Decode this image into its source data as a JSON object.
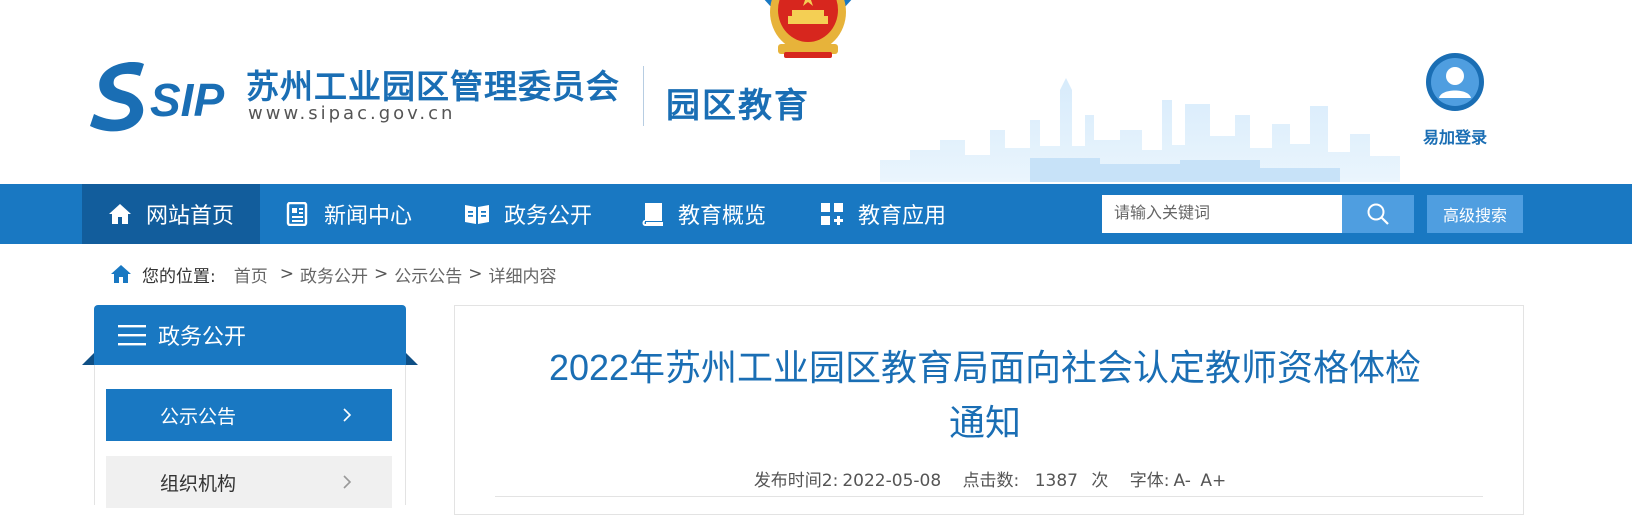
{
  "header": {
    "logo_text": "SIP",
    "org_name": "苏州工业园区管理委员会",
    "org_url": "www.sipac.gov.cn",
    "section_name": "园区教育",
    "login_label": "易加登录"
  },
  "nav": {
    "items": [
      {
        "label": "网站首页",
        "icon": "home-icon",
        "active": true
      },
      {
        "label": "新闻中心",
        "icon": "news-icon",
        "active": false
      },
      {
        "label": "政务公开",
        "icon": "book-icon",
        "active": false
      },
      {
        "label": "教育概览",
        "icon": "notebook-icon",
        "active": false
      },
      {
        "label": "教育应用",
        "icon": "apps-icon",
        "active": false
      }
    ],
    "search_placeholder": "请输入关键词",
    "advanced_search_label": "高级搜索"
  },
  "breadcrumb": {
    "label": "您的位置:",
    "items": [
      "首页",
      "政务公开",
      "公示公告",
      "详细内容"
    ],
    "separator": ">"
  },
  "sidebar": {
    "title": "政务公开",
    "items": [
      {
        "label": "公示公告",
        "active": true
      },
      {
        "label": "组织机构",
        "active": false
      }
    ]
  },
  "article": {
    "title": "2022年苏州工业园区教育局面向社会认定教师资格体检通知",
    "publish_label": "发布时间2:",
    "publish_date": "2022-05-08",
    "clicks_label": "点击数:",
    "clicks": "1387",
    "clicks_unit": "次",
    "font_label": "字体:",
    "font_smaller": "A-",
    "font_larger": "A+"
  },
  "colors": {
    "brand_blue": "#1978c2",
    "nav_active": "#125d9c",
    "title_blue": "#1a6eb4",
    "search_button": "#4f9ee0"
  }
}
